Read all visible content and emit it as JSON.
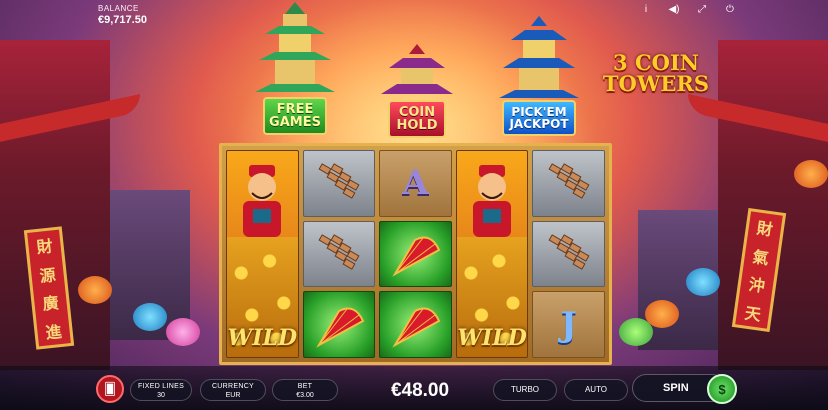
{
  "balance": {
    "label": "BALANCE",
    "value": "€9,717.50"
  },
  "top_icons": [
    {
      "name": "info-icon",
      "glyph": "i"
    },
    {
      "name": "sound-icon",
      "glyph": "◀)"
    },
    {
      "name": "fullscreen-icon",
      "glyph": "⤢"
    },
    {
      "name": "power-icon",
      "glyph": "⏻"
    }
  ],
  "towers": [
    {
      "sign_line1": "FREE",
      "sign_line2": "GAMES",
      "color": "#2fa62a"
    },
    {
      "sign_line1": "COIN",
      "sign_line2": "HOLD",
      "color": "#c8183a"
    },
    {
      "sign_line1": "PICK'EM",
      "sign_line2": "JACKPOT",
      "color": "#1a78e0"
    }
  ],
  "logo": {
    "line1": "3 COIN",
    "line2": "TOWERS"
  },
  "banners": {
    "left": [
      "財",
      "源",
      "廣",
      "進"
    ],
    "right": [
      "財",
      "氣",
      "沖",
      "天"
    ]
  },
  "reels": {
    "wild_label": "WILD",
    "letters": {
      "a": "A",
      "j": "J"
    },
    "grid": [
      [
        "wild",
        "wild",
        "wild"
      ],
      [
        "firecrackers",
        "firecrackers",
        "fan"
      ],
      [
        "A",
        "fan",
        "fan"
      ],
      [
        "wild",
        "wild",
        "wild"
      ],
      [
        "firecrackers",
        "firecrackers",
        "J"
      ]
    ]
  },
  "bottom_bar": {
    "fixed_lines": {
      "label": "FIXED LINES",
      "value": "30"
    },
    "currency": {
      "label": "CURRENCY",
      "value": "EUR"
    },
    "bet": {
      "label": "BET",
      "value": "€3.00"
    },
    "amount": "€48.00",
    "turbo": "TURBO",
    "auto": "AUTO",
    "spin": "SPIN"
  },
  "colors": {
    "accent_gold": "#e5b24e",
    "spin_green": "#1b8a1b",
    "card_red": "#b0161f"
  }
}
